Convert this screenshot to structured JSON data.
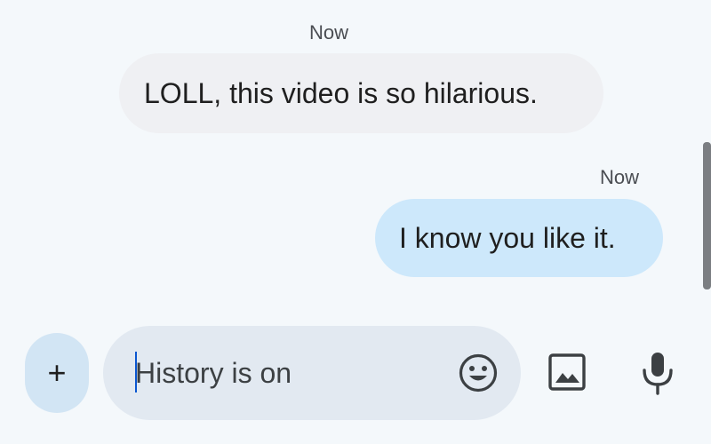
{
  "conversation": {
    "messages": [
      {
        "direction": "incoming",
        "timestamp": "Now",
        "text": "LOLL, this video is so hilarious."
      },
      {
        "direction": "outgoing",
        "timestamp": "Now",
        "text": "I know you like it."
      }
    ]
  },
  "composer": {
    "attach_label": "+",
    "placeholder": "History is on",
    "value": "",
    "icons": {
      "emoji": "emoji-icon",
      "image": "image-icon",
      "voice": "mic-icon"
    }
  },
  "colors": {
    "background": "#f4f8fb",
    "incoming_bubble": "#eff0f3",
    "outgoing_bubble": "#cde8fb",
    "compose_field": "#e2e9f1",
    "attach_button": "#d2e5f4",
    "icon": "#3c4043"
  }
}
